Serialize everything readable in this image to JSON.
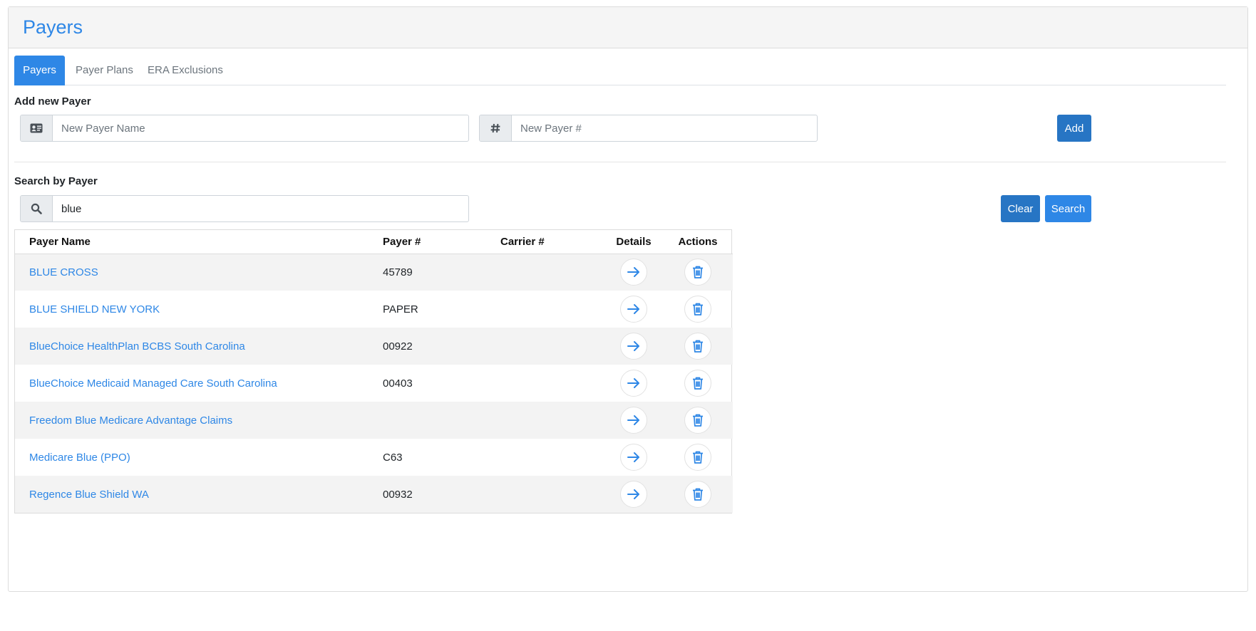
{
  "page": {
    "title": "Payers"
  },
  "tabs": [
    {
      "label": "Payers",
      "active": true
    },
    {
      "label": "Payer Plans",
      "active": false
    },
    {
      "label": "ERA Exclusions",
      "active": false
    }
  ],
  "add_payer": {
    "label": "Add new Payer",
    "name_placeholder": "New Payer Name",
    "name_value": "",
    "number_placeholder": "New Payer #",
    "number_value": "",
    "name_icon": "id-card-icon",
    "number_icon": "hash-icon",
    "add_button": "Add"
  },
  "search": {
    "label": "Search by Payer",
    "value": "blue",
    "placeholder": "",
    "icon": "search-icon",
    "clear_button": "Clear",
    "search_button": "Search"
  },
  "table": {
    "columns": [
      "Payer Name",
      "Payer #",
      "Carrier #",
      "Details",
      "Actions"
    ],
    "rows": [
      {
        "name": "BLUE CROSS",
        "payer_number": "45789",
        "carrier_number": ""
      },
      {
        "name": "BLUE SHIELD NEW YORK",
        "payer_number": "PAPER",
        "carrier_number": ""
      },
      {
        "name": "BlueChoice HealthPlan BCBS South Carolina",
        "payer_number": "00922",
        "carrier_number": ""
      },
      {
        "name": "BlueChoice Medicaid Managed Care South Carolina",
        "payer_number": "00403",
        "carrier_number": ""
      },
      {
        "name": "Freedom Blue Medicare Advantage Claims",
        "payer_number": "",
        "carrier_number": ""
      },
      {
        "name": "Medicare Blue (PPO)",
        "payer_number": "C63",
        "carrier_number": ""
      },
      {
        "name": "Regence Blue Shield WA",
        "payer_number": "00932",
        "carrier_number": ""
      }
    ],
    "details_icon": "arrow-right-icon",
    "actions_icon": "trash-icon"
  },
  "colors": {
    "accent": "#2e87e6",
    "button_dark": "#2775c4",
    "header_bg": "#f5f5f5",
    "row_stripe": "#f3f3f3"
  }
}
